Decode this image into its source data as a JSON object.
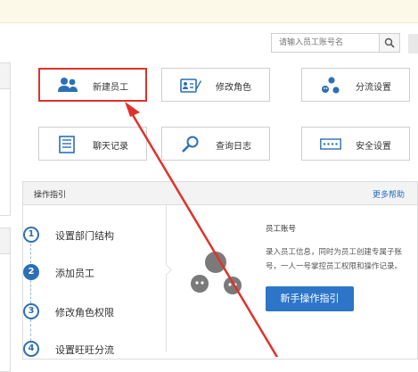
{
  "search": {
    "placeholder": "请输入员工账号名"
  },
  "buttons": [
    {
      "label": "新建员工",
      "icon": "user-group-icon",
      "highlighted": true
    },
    {
      "label": "修改角色",
      "icon": "id-card-edit-icon"
    },
    {
      "label": "分流设置",
      "icon": "flow-split-icon"
    },
    {
      "label": "聊天记录",
      "icon": "chat-log-icon"
    },
    {
      "label": "查询日志",
      "icon": "magnifier-icon"
    },
    {
      "label": "安全设置",
      "icon": "password-dots-icon"
    }
  ],
  "guide": {
    "title": "操作指引",
    "more": "更多帮助",
    "steps": [
      {
        "num": "1",
        "label": "设置部门结构"
      },
      {
        "num": "2",
        "label": "添加员工",
        "active": true
      },
      {
        "num": "3",
        "label": "修改角色权限"
      },
      {
        "num": "4",
        "label": "设置旺旺分流"
      }
    ],
    "right_title": "员工账号",
    "right_desc": "录入员工信息，同时为员工创建专属子账号，一人一号掌控员工权限和操作记录。",
    "action_button": "新手操作指引"
  },
  "colors": {
    "accent": "#2c6fb5",
    "highlight_border": "#e0322b",
    "link": "#1f6fc4"
  }
}
